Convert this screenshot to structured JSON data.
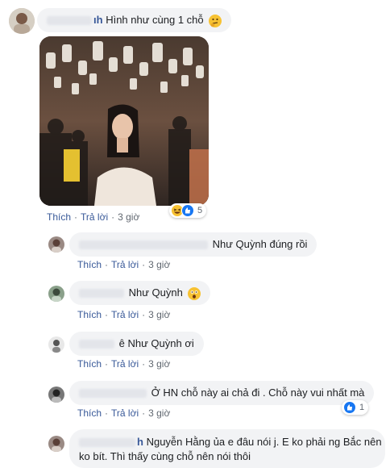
{
  "comment1": {
    "author": "Như Quỳnh",
    "text": "Hình như cùng 1 chỗ",
    "emoji": "thinking-face-emoji",
    "actions": {
      "like": "Thích",
      "reply": "Trả lời",
      "time": "3 giờ"
    },
    "reactions": {
      "count": "5",
      "icons": [
        "haha-icon",
        "like-icon"
      ]
    }
  },
  "replies": [
    {
      "author": "Huỳnh Ngọc Thùy Dương",
      "text": "Như Quỳnh đúng rồi",
      "actions": {
        "like": "Thích",
        "reply": "Trả lời",
        "time": "3 giờ"
      }
    },
    {
      "author": "",
      "text": "Như Quỳnh",
      "emoji": "astonished-face-emoji",
      "actions": {
        "like": "Thích",
        "reply": "Trả lời",
        "time": "3 giờ"
      }
    },
    {
      "author": "",
      "text": "ê Như Quỳnh ơi",
      "actions": {
        "like": "Thích",
        "reply": "Trả lời",
        "time": "3 giờ"
      }
    },
    {
      "author": "",
      "text": "Ở HN chỗ này ai chả đi . Chỗ này vui nhất mà",
      "actions": {
        "like": "Thích",
        "reply": "Trả lời",
        "time": "3 giờ"
      },
      "reactions": {
        "count": "1",
        "icons": [
          "like-icon"
        ]
      }
    },
    {
      "author": "h",
      "text_line1": "Nguyễn Hằng ủa e đâu nói j. E ko phải ng Bắc nên",
      "text_line2": "ko bít. Thì thấy cùng chỗ nên nói thôi"
    }
  ],
  "colors": {
    "link": "#385898",
    "bubble": "#f2f3f5",
    "meta": "#606770",
    "like": "#1877f2",
    "haha": "#f7c233"
  }
}
